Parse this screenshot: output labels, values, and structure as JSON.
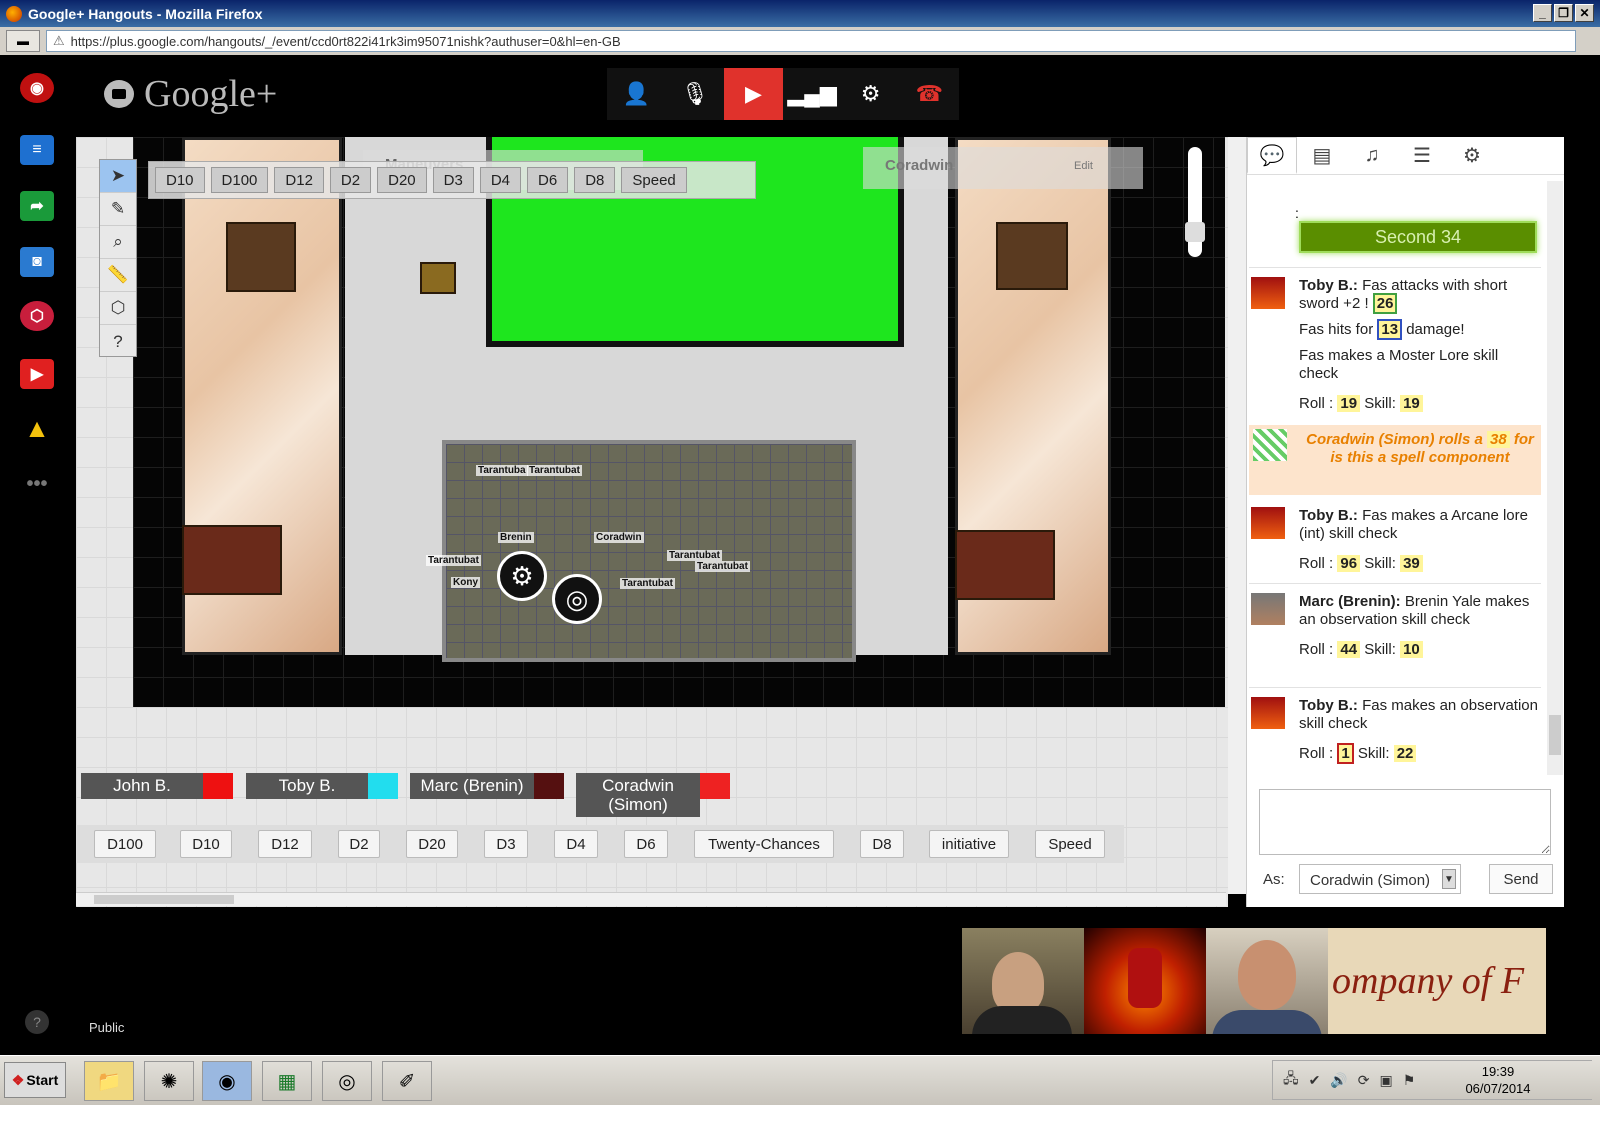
{
  "window": {
    "title": "Google+ Hangouts - Mozilla Firefox",
    "min": "_",
    "max": "❐",
    "close": "✕"
  },
  "browser": {
    "url": "https://plus.google.com/hangouts/_/event/ccd0rt822i41rk3im95071nishk?authuser=0&hl=en-GB"
  },
  "app": {
    "brand": "Google+"
  },
  "map": {
    "tokens": [
      "Tarantuba",
      "Tarantubat",
      "Brenin",
      "Coradwin",
      "Tarantubat",
      "Tarantubat",
      "Tarantubat",
      "Tarantubat",
      "Kony"
    ]
  },
  "toolbar_dice": [
    "D10",
    "D100",
    "D12",
    "D2",
    "D20",
    "D3",
    "D4",
    "D6",
    "D8",
    "Speed"
  ],
  "maneuvers": {
    "title": "Maneuvers"
  },
  "character_card": {
    "name": "Coradwin",
    "edit": "Edit"
  },
  "players": [
    {
      "name": "John B.",
      "color": "#ee1111"
    },
    {
      "name": "Toby B.",
      "color": "#22ddee"
    },
    {
      "name": "Marc (Brenin)",
      "color": "#551010"
    },
    {
      "name": "Coradwin\n(Simon)",
      "color": "#ee2222"
    }
  ],
  "dice_row": [
    "D100",
    "D10",
    "D12",
    "D2",
    "D20",
    "D3",
    "D4",
    "D6",
    "Twenty-Chances",
    "D8",
    "initiative",
    "Speed"
  ],
  "chat": {
    "colon": ":",
    "turn": "Second 34",
    "messages": [
      {
        "who": "Toby B.:",
        "text": "Fas attacks with short sword +2 !",
        "val": "26",
        "l2a": "Fas hits for",
        "l2v": "13",
        "l2b": "damage!",
        "l3": "Fas makes a Moster Lore skill check",
        "roll_lbl": "Roll :",
        "roll": "19",
        "skill_lbl": "Skill:",
        "skill": "19"
      },
      {
        "spell_a": "Coradwin (Simon) rolls a",
        "spell_v": "38",
        "spell_b": "for is this a spell component"
      },
      {
        "who": "Toby B.:",
        "text": "Fas makes a Arcane lore (int) skill check",
        "roll_lbl": "Roll :",
        "roll": "96",
        "skill_lbl": "Skill:",
        "skill": "39"
      },
      {
        "who": "Marc (Brenin):",
        "text": "Brenin Yale makes an observation skill check",
        "roll_lbl": "Roll :",
        "roll": "44",
        "skill_lbl": "Skill:",
        "skill": "10"
      },
      {
        "who": "Toby B.:",
        "text": "Fas makes an observation skill check",
        "roll_lbl": "Roll :",
        "roll": "1",
        "skill_lbl": "Skill:",
        "skill": "22"
      }
    ],
    "as_label": "As:",
    "as_value": "Coradwin (Simon)",
    "send": "Send"
  },
  "video": {
    "banner": "ompany of F"
  },
  "footer": {
    "public": "Public",
    "help": "?"
  },
  "taskbar": {
    "start": "Start",
    "time": "19:39",
    "date": "06/07/2014"
  }
}
